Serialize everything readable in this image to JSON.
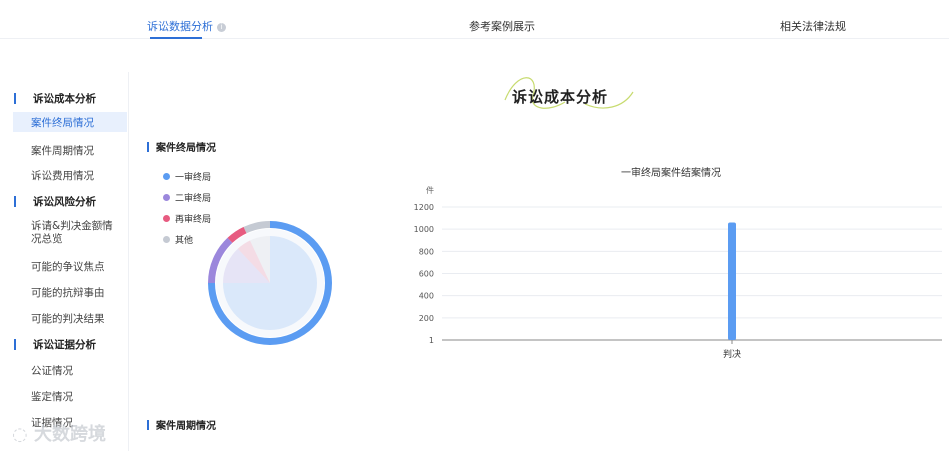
{
  "tabs": [
    {
      "label": "诉讼数据分析",
      "active": true
    },
    {
      "label": "参考案例展示",
      "active": false
    },
    {
      "label": "相关法律法规",
      "active": false
    }
  ],
  "sidebar": {
    "groups": [
      {
        "label": "诉讼成本分析",
        "items": [
          "案件终局情况",
          "案件周期情况",
          "诉讼费用情况"
        ]
      },
      {
        "label": "诉讼风险分析",
        "items": [
          "诉请&判决金额情况总览",
          "可能的争议焦点",
          "可能的抗辩事由",
          "可能的判决结果"
        ]
      },
      {
        "label": "诉讼证据分析",
        "items": [
          "公证情况",
          "鉴定情况",
          "证据情况"
        ]
      }
    ],
    "active_item": "案件终局情况"
  },
  "main": {
    "title": "诉讼成本分析",
    "section1_title": "案件终局情况",
    "section2_title": "案件周期情况"
  },
  "legend": [
    {
      "label": "一审终局",
      "color": "#5b9cf2"
    },
    {
      "label": "二审终局",
      "color": "#9b87dc"
    },
    {
      "label": "再审终局",
      "color": "#e75b80"
    },
    {
      "label": "其他",
      "color": "#c5cad3"
    }
  ],
  "chart_data": [
    {
      "type": "pie",
      "labels": [
        "一审终局",
        "二审终局",
        "再审终局",
        "其他"
      ],
      "values": [
        75,
        13,
        5,
        7
      ],
      "colors": [
        "#5b9cf2",
        "#9b87dc",
        "#e75b80",
        "#c5cad3"
      ]
    },
    {
      "type": "bar",
      "title": "一审终局案件结案情况",
      "ylabel": "件",
      "categories": [
        "判决"
      ],
      "values": [
        1060
      ],
      "yticks": [
        1,
        200,
        400,
        600,
        800,
        1000,
        1200
      ],
      "ylim": [
        0,
        1200
      ],
      "color": "#5b9cf2"
    }
  ],
  "watermark": "大数跨境"
}
